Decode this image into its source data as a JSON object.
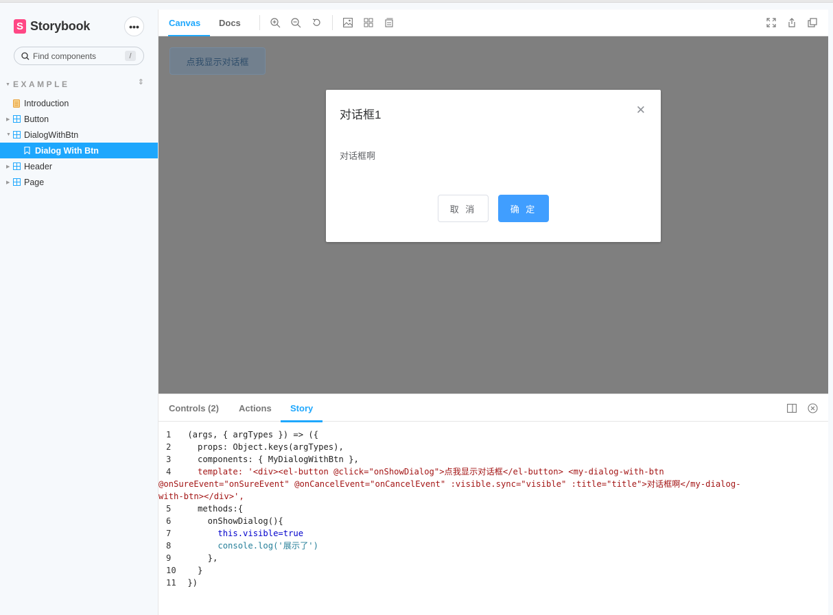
{
  "app": {
    "name": "Storybook"
  },
  "sidebar": {
    "search_placeholder": "Find components",
    "search_shortcut": "/",
    "section_label": "EXAMPLE",
    "items": [
      {
        "label": "Introduction",
        "icon": "document-icon"
      },
      {
        "label": "Button",
        "icon": "component-icon"
      },
      {
        "label": "DialogWithBtn",
        "icon": "component-icon"
      },
      {
        "label": "Dialog With Btn",
        "icon": "bookmark-icon",
        "active": true
      },
      {
        "label": "Header",
        "icon": "component-icon"
      },
      {
        "label": "Page",
        "icon": "component-icon"
      }
    ]
  },
  "toolbar": {
    "tabs": [
      "Canvas",
      "Docs"
    ],
    "active_tab": "Canvas"
  },
  "canvas": {
    "show_button": "点我显示对话框",
    "dialog": {
      "title": "对话框1",
      "body": "对话框啊",
      "cancel": "取 消",
      "confirm": "确 定"
    }
  },
  "addons": {
    "tabs": [
      "Controls (2)",
      "Actions",
      "Story"
    ],
    "active_tab": "Story",
    "code_lines": [
      {
        "n": "1",
        "text": " (args, { argTypes }) => ({"
      },
      {
        "n": "2",
        "text": "   props: Object.keys(argTypes),"
      },
      {
        "n": "3",
        "text": "   components: { MyDialogWithBtn },"
      },
      {
        "n": "4",
        "text": "   template: '<div><el-button @click=\"onShowDialog\">点我显示对话框</el-button> <my-dialog-with-btn"
      },
      {
        "n": "",
        "text": "@onSureEvent=\"onSureEvent\" @onCancelEvent=\"onCancelEvent\" :visible.sync=\"visible\" :title=\"title\">对话框啊</my-dialog-"
      },
      {
        "n": "",
        "text": "with-btn></div>',"
      },
      {
        "n": "5",
        "text": "   methods:{"
      },
      {
        "n": "6",
        "text": "     onShowDialog(){"
      },
      {
        "n": "7",
        "text": "       this.visible=true"
      },
      {
        "n": "8",
        "text": "       console.log('展示了')"
      },
      {
        "n": "9",
        "text": "     },"
      },
      {
        "n": "10",
        "text": "   }"
      },
      {
        "n": "11",
        "text": " })"
      }
    ]
  },
  "colors": {
    "accent": "#1ea7fd",
    "brand": "#ff4785",
    "primary_button": "#409eff",
    "overlay": "#7f7f7f"
  }
}
